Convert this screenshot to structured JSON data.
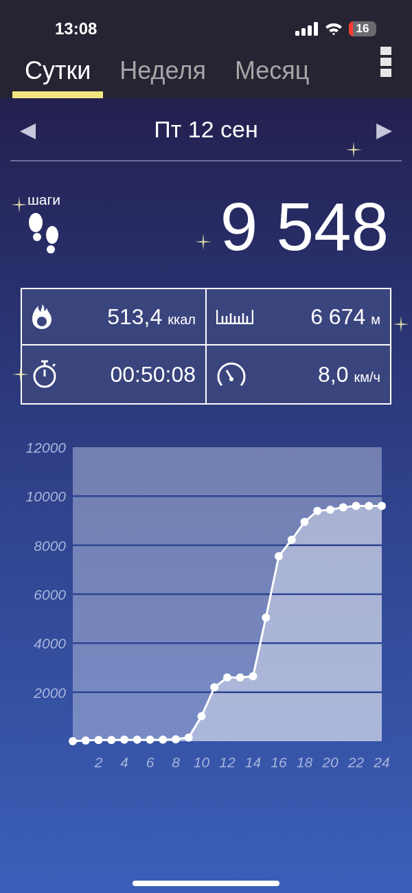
{
  "status_bar": {
    "time": "13:08",
    "battery": "16"
  },
  "tabs": [
    {
      "label": "Сутки",
      "selected": true
    },
    {
      "label": "Неделя",
      "selected": false
    },
    {
      "label": "Месяц",
      "selected": false
    }
  ],
  "date_nav": {
    "prev": "◀",
    "date": "Пт 12 сен",
    "next": "▶"
  },
  "steps": {
    "label": "шаги",
    "value": "9 548"
  },
  "stats": [
    {
      "kind": "calories",
      "value": "513,4",
      "unit": "ккал"
    },
    {
      "kind": "distance",
      "value": "6 674",
      "unit": "м"
    },
    {
      "kind": "duration",
      "value": "00:50:08"
    },
    {
      "kind": "speed",
      "value": "8,0",
      "unit": "км/ч"
    }
  ],
  "chart": {
    "chart_data": {
      "type": "area",
      "x": [
        0,
        1,
        2,
        3,
        4,
        5,
        6,
        7,
        8,
        9,
        10,
        11,
        12,
        13,
        14,
        15,
        16,
        17,
        18,
        19,
        20,
        21,
        22,
        23,
        24
      ],
      "grid": true,
      "series": [
        {
          "color": "#ffffff",
          "values": [
            0,
            30,
            50,
            50,
            60,
            60,
            60,
            60,
            80,
            150,
            1020,
            2200,
            2600,
            2600,
            2650,
            5050,
            7550,
            8220,
            8950,
            9400,
            9450,
            9550,
            9600,
            9600,
            9600
          ]
        }
      ],
      "xlim": [
        0,
        24
      ],
      "ylim": [
        0,
        12000
      ],
      "xticks": [
        2,
        4,
        6,
        8,
        10,
        12,
        14,
        16,
        18,
        20,
        22,
        24
      ],
      "yticks": [
        2000,
        4000,
        6000,
        8000,
        10000,
        12000
      ]
    }
  }
}
